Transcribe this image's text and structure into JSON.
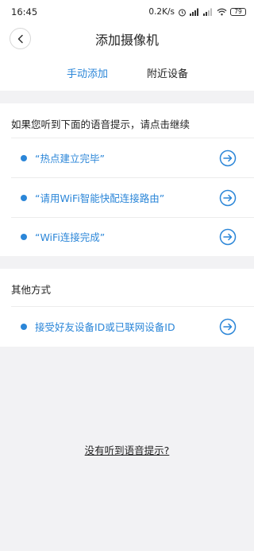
{
  "status_bar": {
    "time": "16:45",
    "network_speed": "0.2K/s",
    "battery": "79"
  },
  "header": {
    "title": "添加摄像机"
  },
  "tabs": [
    {
      "label": "手动添加",
      "active": true
    },
    {
      "label": "附近设备",
      "active": false
    }
  ],
  "voice_section": {
    "title": "如果您听到下面的语音提示，请点击继续",
    "items": [
      {
        "label": "“热点建立完毕”"
      },
      {
        "label": "“请用WiFi智能快配连接路由”"
      },
      {
        "label": "“WiFi连接完成”"
      }
    ]
  },
  "other_section": {
    "title": "其他方式",
    "items": [
      {
        "label": "接受好友设备ID或已联网设备ID"
      }
    ]
  },
  "footer": {
    "link": "没有听到语音提示?"
  },
  "colors": {
    "accent": "#2b86d8",
    "background": "#f2f2f4",
    "panel": "#ffffff"
  },
  "icons": {
    "back": "chevron-left-icon",
    "go": "arrow-right-circle-icon",
    "bullet": "dot-icon"
  }
}
